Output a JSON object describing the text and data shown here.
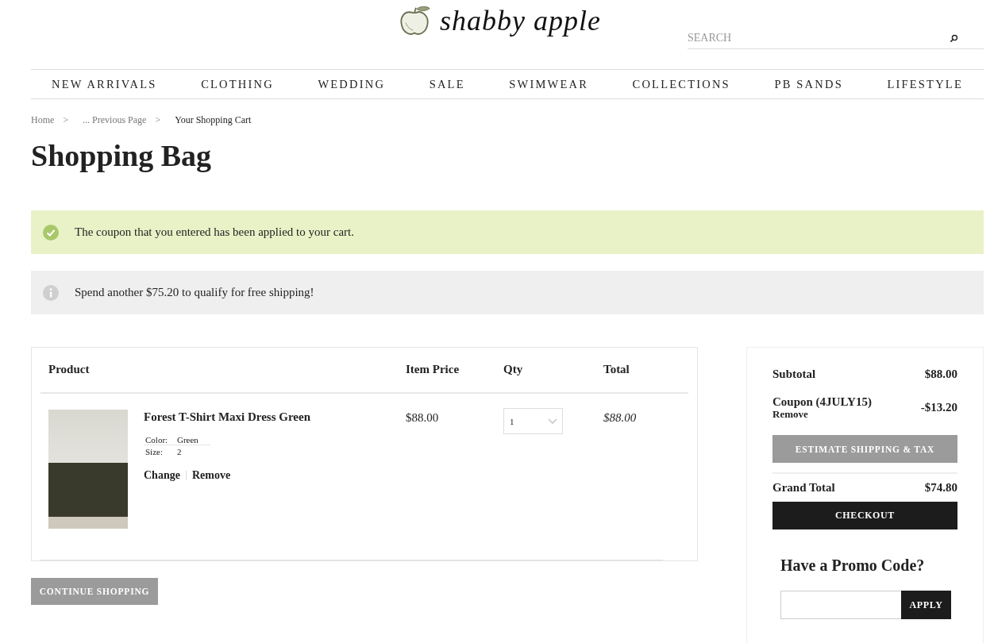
{
  "header": {
    "logo": "shabby apple",
    "search": {
      "placeholder": "SEARCH"
    }
  },
  "nav": [
    "NEW ARRIVALS",
    "CLOTHING",
    "WEDDING",
    "SALE",
    "SWIMWEAR",
    "COLLECTIONS",
    "PB SANDS",
    "LIFESTYLE"
  ],
  "breadcrumb": [
    {
      "kind": "link",
      "label": "Home"
    },
    {
      "kind": "separator",
      "label": ">"
    },
    {
      "kind": "link",
      "label": "... Previous Page"
    },
    {
      "kind": "separator",
      "label": ">"
    },
    {
      "kind": "current",
      "label": "Your Shopping Cart"
    }
  ],
  "heading": "Shopping Bag",
  "alerts": [
    {
      "kind": "success",
      "text": "The coupon that you entered has been applied to your cart."
    },
    {
      "kind": "info",
      "text": "Spend another $75.20 to qualify for free shipping!"
    }
  ],
  "cart": {
    "columns": [
      "Product",
      "Item Price",
      "Qty",
      "Total"
    ],
    "rows": [
      {
        "name": "Forest T-Shirt Maxi Dress Green",
        "options": [
          {
            "label": "Color:",
            "value": "Green"
          },
          {
            "label": "Size:",
            "value": "2"
          }
        ],
        "actions": [
          "Change",
          "Remove"
        ],
        "price": "$88.00",
        "qty": "1",
        "total": "$88.00"
      }
    ]
  },
  "continue_button": "CONTINUE SHOPPING",
  "summary": {
    "subtotal": {
      "label": "Subtotal",
      "value": "$88.00"
    },
    "coupon": {
      "label": "Coupon (4JULY15)",
      "remove": "Remove",
      "value": "-$13.20"
    },
    "estimate_button": "ESTIMATE SHIPPING & TAX",
    "grand_total": {
      "label": "Grand Total",
      "value": "$74.80"
    },
    "checkout_button": "CHECKOUT",
    "promo": {
      "title": "Have a Promo Code?",
      "button": "APPLY"
    }
  }
}
